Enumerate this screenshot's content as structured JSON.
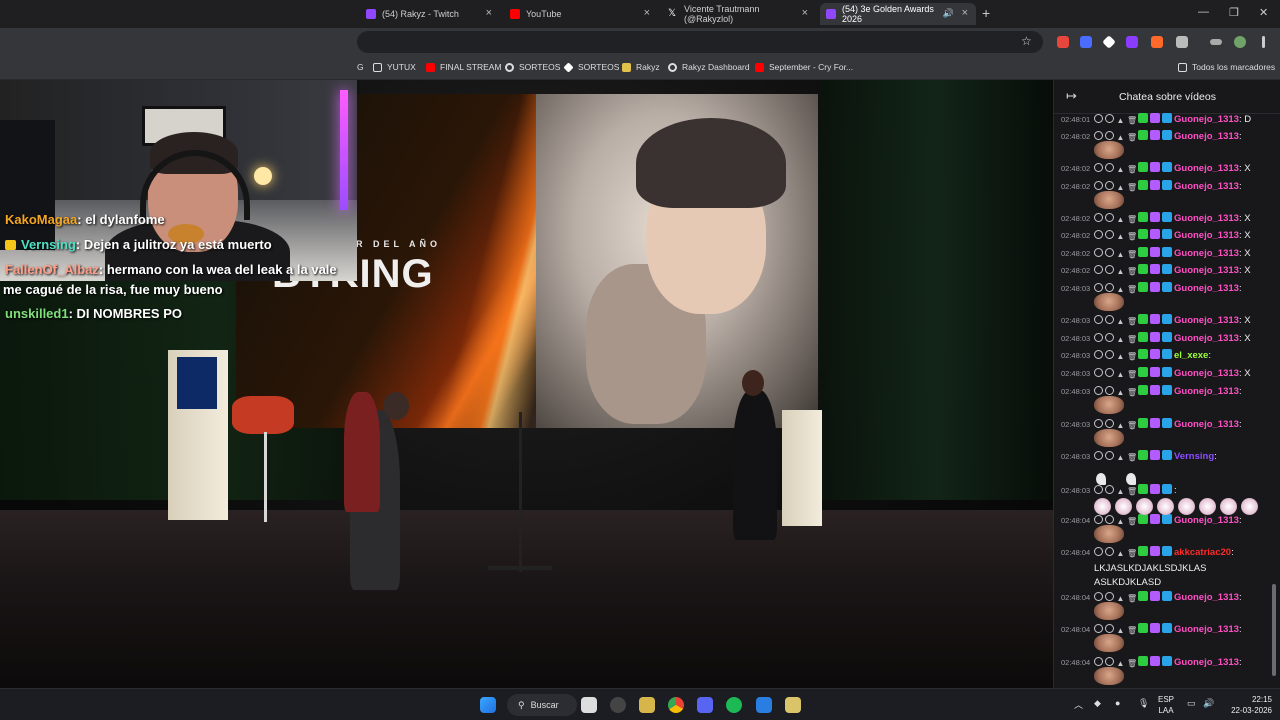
{
  "browser": {
    "tabs": [
      {
        "title": "(54) Rakyz - Twitch",
        "color": "#9146ff"
      },
      {
        "title": "YouTube",
        "color": "#ff0000"
      },
      {
        "title": "Vicente Trautmann (@Rakyzlol)",
        "color": "#ffffff"
      },
      {
        "title": "(54) 3e Golden Awards 2026",
        "color": "#9146ff"
      }
    ],
    "new_tab": "+",
    "bookmarks": [
      {
        "label": "YUTUX",
        "icon": "folder-icon"
      },
      {
        "label": "FINAL STREAM",
        "icon": "youtube-icon"
      },
      {
        "label": "SORTEOS",
        "icon": "gear-icon"
      },
      {
        "label": "SORTEOS",
        "icon": "diamond-icon"
      },
      {
        "label": "Rakyz",
        "icon": "bolt-icon"
      },
      {
        "label": "Rakyz Dashboard",
        "icon": "gear-icon"
      },
      {
        "label": "September - Cry For...",
        "icon": "youtube-icon"
      }
    ],
    "all_bookmarks": "Todos los marcadores"
  },
  "stream": {
    "screen_subtitle": "STREAMER DEL AÑO",
    "screen_title": "BYKING",
    "overlay_chat": [
      {
        "user": "KakoMagaa",
        "color": "#f5a623",
        "text": ": el dylanfome",
        "badge": false
      },
      {
        "user": "Vernsing",
        "color": "#4fe0c4",
        "text": ": Dejen a julitroz ya está muerto",
        "badge": true
      },
      {
        "user": "FallenOf_Albaz",
        "color": "#ff9f8a",
        "text": ": hermano con la wea del leak a la vale",
        "badge": false
      },
      {
        "user": "",
        "color": "#ffffff",
        "text": "me cagué de la risa, fue muy bueno",
        "badge": false
      },
      {
        "user": "unskilled1",
        "color": "#7fe07a",
        "text": ": DI NOMBRES PO",
        "badge": false
      }
    ]
  },
  "chat": {
    "title": "Chatea sobre vídeos",
    "messages": [
      {
        "time": "02:48:01",
        "user": "Guonejo_1313",
        "color": "#ff4fc4",
        "text": ": D",
        "emote": false
      },
      {
        "time": "02:48:02",
        "user": "Guonejo_1313",
        "color": "#ff4fc4",
        "text": ":",
        "emote": true
      },
      {
        "time": "02:48:02",
        "user": "Guonejo_1313",
        "color": "#ff4fc4",
        "text": ": X",
        "emote": false
      },
      {
        "time": "02:48:02",
        "user": "Guonejo_1313",
        "color": "#ff4fc4",
        "text": ":",
        "emote": true
      },
      {
        "time": "02:48:02",
        "user": "Guonejo_1313",
        "color": "#ff4fc4",
        "text": ": X",
        "emote": false
      },
      {
        "time": "02:48:02",
        "user": "Guonejo_1313",
        "color": "#ff4fc4",
        "text": ": X",
        "emote": false
      },
      {
        "time": "02:48:02",
        "user": "Guonejo_1313",
        "color": "#ff4fc4",
        "text": ": X",
        "emote": false
      },
      {
        "time": "02:48:02",
        "user": "Guonejo_1313",
        "color": "#ff4fc4",
        "text": ": X",
        "emote": false
      },
      {
        "time": "02:48:03",
        "user": "Guonejo_1313",
        "color": "#ff4fc4",
        "text": ":",
        "emote": true
      },
      {
        "time": "02:48:03",
        "user": "Guonejo_1313",
        "color": "#ff4fc4",
        "text": ": X",
        "emote": false
      },
      {
        "time": "02:48:03",
        "user": "Guonejo_1313",
        "color": "#ff4fc4",
        "text": ": X",
        "emote": false
      },
      {
        "time": "02:48:03",
        "user": "el_xexe",
        "color": "#9cff3a",
        "text": ":",
        "emote": false
      },
      {
        "time": "02:48:03",
        "user": "Guonejo_1313",
        "color": "#ff4fc4",
        "text": ": X",
        "emote": false
      },
      {
        "time": "02:48:03",
        "user": "Guonejo_1313",
        "color": "#ff4fc4",
        "text": ":",
        "emote": true
      },
      {
        "time": "02:48:03",
        "user": "Guonejo_1313",
        "color": "#ff4fc4",
        "text": ":",
        "emote": true
      },
      {
        "time": "02:48:03",
        "user": "Vernsing",
        "color": "#8a4dff",
        "text": ":",
        "emote": false
      },
      {
        "time": "02:48:03",
        "user": "",
        "color": "#3a3aff",
        "text": ":",
        "emote": false
      },
      {
        "time": "02:48:04",
        "user": "Guonejo_1313",
        "color": "#ff4fc4",
        "text": ":",
        "emote": true
      },
      {
        "time": "02:48:04",
        "user": "akkcatriac20",
        "color": "#ff2a2a",
        "text": ":",
        "emote": false
      },
      {
        "time": "02:48:04",
        "user": "Guonejo_1313",
        "color": "#ff4fc4",
        "text": ":",
        "emote": true
      },
      {
        "time": "02:48:04",
        "user": "Guonejo_1313",
        "color": "#ff4fc4",
        "text": ":",
        "emote": true
      },
      {
        "time": "02:48:04",
        "user": "Guonejo_1313",
        "color": "#ff4fc4",
        "text": ":",
        "emote": true
      }
    ],
    "spam_line_1": "LKJASLKDJAKLSDJKLAS",
    "spam_line_2": "ASLKDJKLASD"
  },
  "taskbar": {
    "search_label": "Buscar",
    "lang_1": "ESP",
    "lang_2": "LAA",
    "time": "22:15",
    "date": "22-03-2026"
  }
}
